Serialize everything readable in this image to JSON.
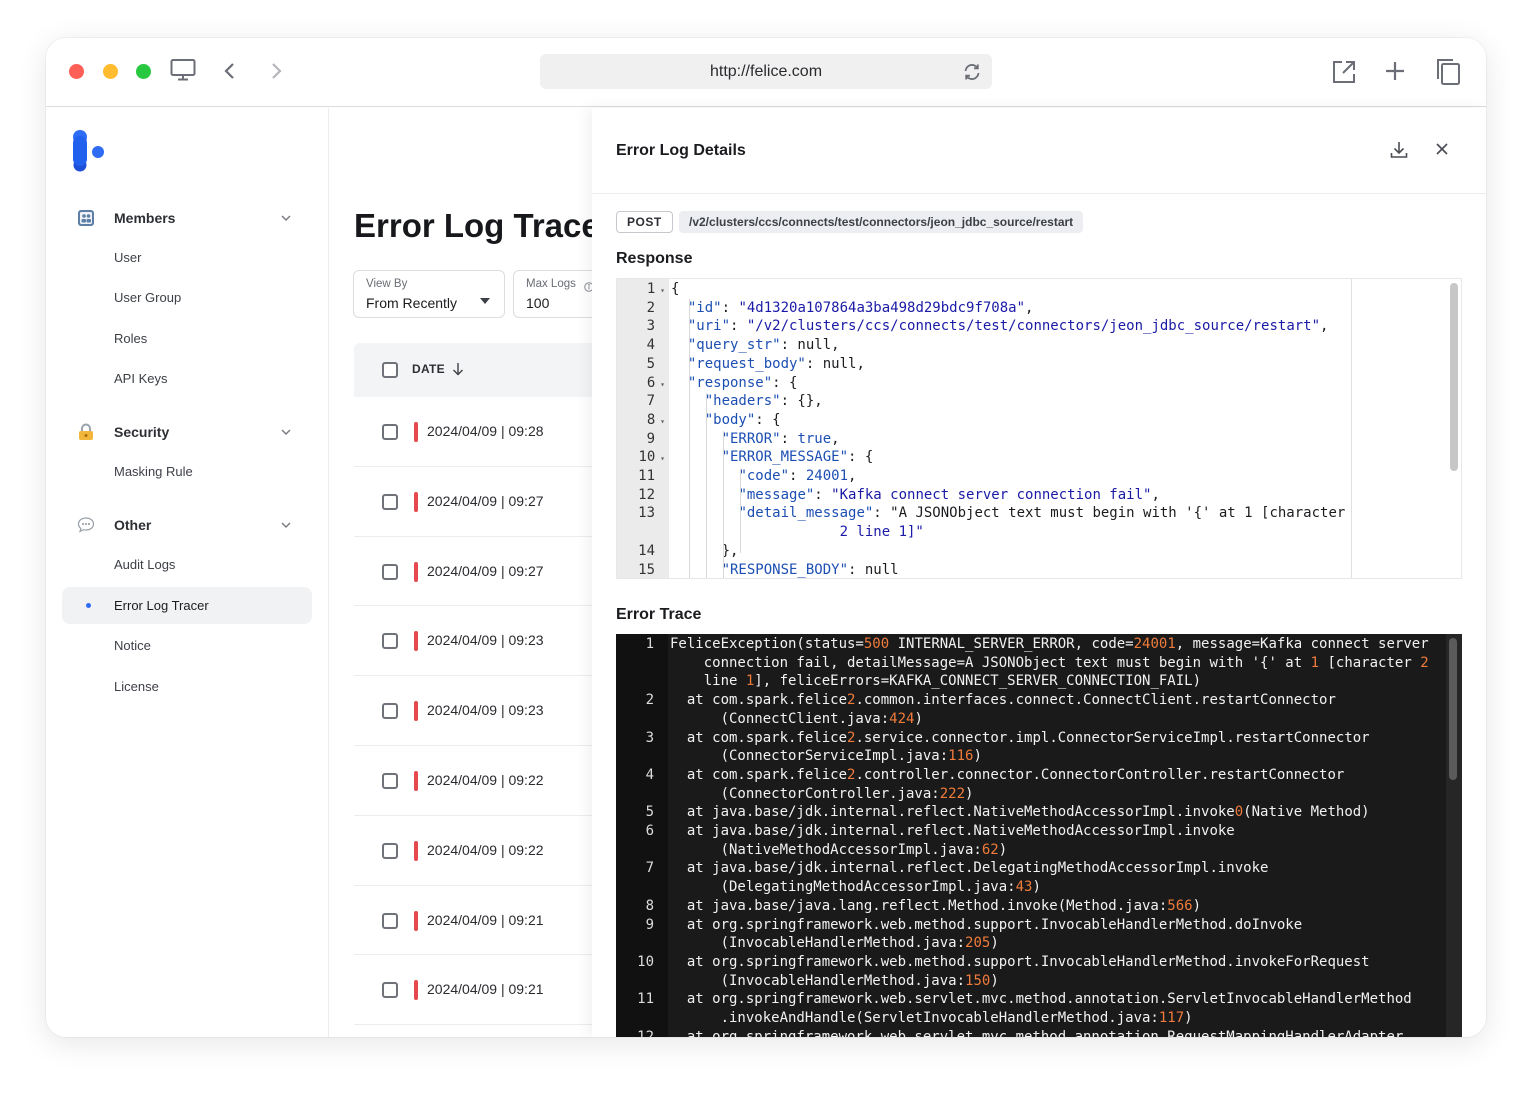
{
  "browser": {
    "url": "http://felice.com"
  },
  "sidebar": {
    "groups": [
      {
        "label": "Members",
        "items": [
          "User",
          "User Group",
          "Roles",
          "API Keys"
        ]
      },
      {
        "label": "Security",
        "items": [
          "Masking Rule"
        ]
      },
      {
        "label": "Other",
        "items": [
          "Audit Logs",
          "Error Log Tracer",
          "Notice",
          "License"
        ]
      }
    ],
    "active_item": "Error Log Tracer"
  },
  "main": {
    "title": "Error Log Trace",
    "view_by": {
      "label": "View By",
      "value": "From Recently"
    },
    "max_logs": {
      "label": "Max Logs",
      "value": "100"
    },
    "table": {
      "date_header": "DATE",
      "rows": [
        "2024/04/09 | 09:28",
        "2024/04/09 | 09:27",
        "2024/04/09 | 09:27",
        "2024/04/09 | 09:23",
        "2024/04/09 | 09:23",
        "2024/04/09 | 09:22",
        "2024/04/09 | 09:22",
        "2024/04/09 | 09:21",
        "2024/04/09 | 09:21"
      ]
    }
  },
  "details": {
    "title": "Error Log Details",
    "method": "POST",
    "path": "/v2/clusters/ccs/connects/test/connectors/jeon_jdbc_source/restart",
    "response_title": "Response",
    "trace_title": "Error Trace",
    "response_lines": [
      "{",
      "  \"id\": \"4d1320a107864a3ba498d29bdc9f708a\",",
      "  \"uri\": \"/v2/clusters/ccs/connects/test/connectors/jeon_jdbc_source/restart\",",
      "  \"query_str\": null,",
      "  \"request_body\": null,",
      "  \"response\": {",
      "    \"headers\": {},",
      "    \"body\": {",
      "      \"ERROR\": true,",
      "      \"ERROR_MESSAGE\": {",
      "        \"code\": 24001,",
      "        \"message\": \"Kafka connect server connection fail\",",
      "        \"detail_message\": \"A JSONObject text must begin with '{' at 1 [character 2 line 1]\"",
      "      },",
      "      \"RESPONSE_BODY\": null"
    ],
    "trace_lines": [
      "FeliceException(status=500 INTERNAL_SERVER_ERROR, code=24001, message=Kafka connect server connection fail, detailMessage=A JSONObject text must begin with '{' at 1 [character 2 line 1], feliceErrors=KAFKA_CONNECT_SERVER_CONNECTION_FAIL)",
      "at com.spark.felice2.common.interfaces.connect.ConnectClient.restartConnector (ConnectClient.java:424)",
      "at com.spark.felice2.service.connector.impl.ConnectorServiceImpl.restartConnector (ConnectorServiceImpl.java:116)",
      "at com.spark.felice2.controller.connector.ConnectorController.restartConnector (ConnectorController.java:222)",
      "at java.base/jdk.internal.reflect.NativeMethodAccessorImpl.invoke0(Native Method)",
      "at java.base/jdk.internal.reflect.NativeMethodAccessorImpl.invoke (NativeMethodAccessorImpl.java:62)",
      "at java.base/jdk.internal.reflect.DelegatingMethodAccessorImpl.invoke (DelegatingMethodAccessorImpl.java:43)",
      "at java.base/java.lang.reflect.Method.invoke(Method.java:566)",
      "at org.springframework.web.method.support.InvocableHandlerMethod.doInvoke (InvocableHandlerMethod.java:205)",
      "at org.springframework.web.method.support.InvocableHandlerMethod.invokeForRequest (InvocableHandlerMethod.java:150)",
      "at org.springframework.web.servlet.mvc.method.annotation.ServletInvocableHandlerMethod .invokeAndHandle(ServletInvocableHandlerMethod.java:117)",
      "at org.springframework.web.servlet.mvc.method.annotation.RequestMappingHandlerAdapter"
    ]
  },
  "colors": {
    "accent": "#2f6cf6",
    "error_bar": "#e5484d",
    "trace_number": "#f07c3b",
    "code_bg_dark": "#1a1a1a"
  }
}
